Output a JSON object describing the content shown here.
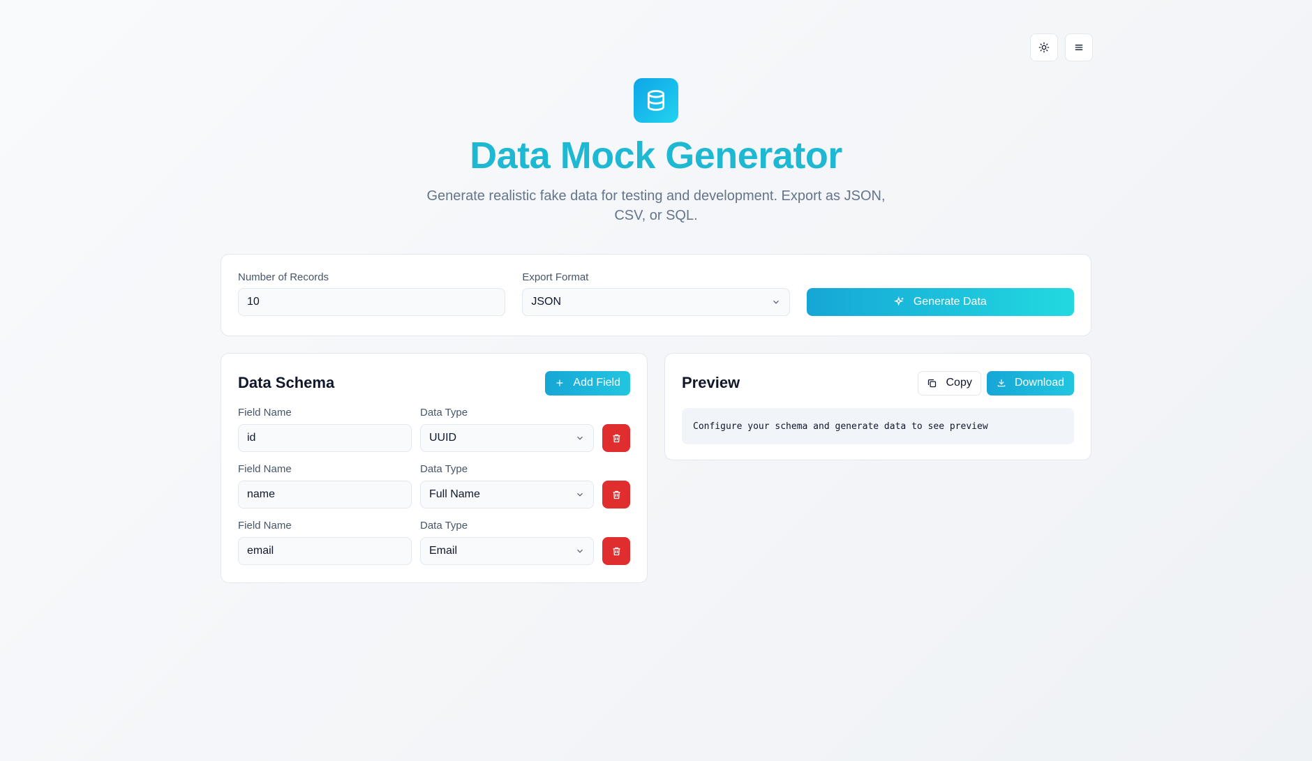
{
  "header": {
    "theme_toggle_icon": "sun-icon",
    "menu_icon": "menu-icon"
  },
  "hero": {
    "logo_icon": "database-icon",
    "title": "Data Mock Generator",
    "subtitle": "Generate realistic fake data for testing and development. Export as JSON, CSV, or SQL."
  },
  "config": {
    "records_label": "Number of Records",
    "records_value": "10",
    "format_label": "Export Format",
    "format_value": "JSON",
    "generate_label": "Generate Data"
  },
  "schema": {
    "title": "Data Schema",
    "add_field_label": "Add Field",
    "fields": [
      {
        "name_label": "Field Name",
        "name_value": "id",
        "type_label": "Data Type",
        "type_value": "UUID"
      },
      {
        "name_label": "Field Name",
        "name_value": "name",
        "type_label": "Data Type",
        "type_value": "Full Name"
      },
      {
        "name_label": "Field Name",
        "name_value": "email",
        "type_label": "Data Type",
        "type_value": "Email"
      }
    ]
  },
  "preview": {
    "title": "Preview",
    "copy_label": "Copy",
    "download_label": "Download",
    "placeholder": "Configure your schema and generate data to see preview"
  },
  "colors": {
    "accent": "#1fb8d3",
    "danger": "#e02e2e",
    "border": "#e2e8f0"
  }
}
